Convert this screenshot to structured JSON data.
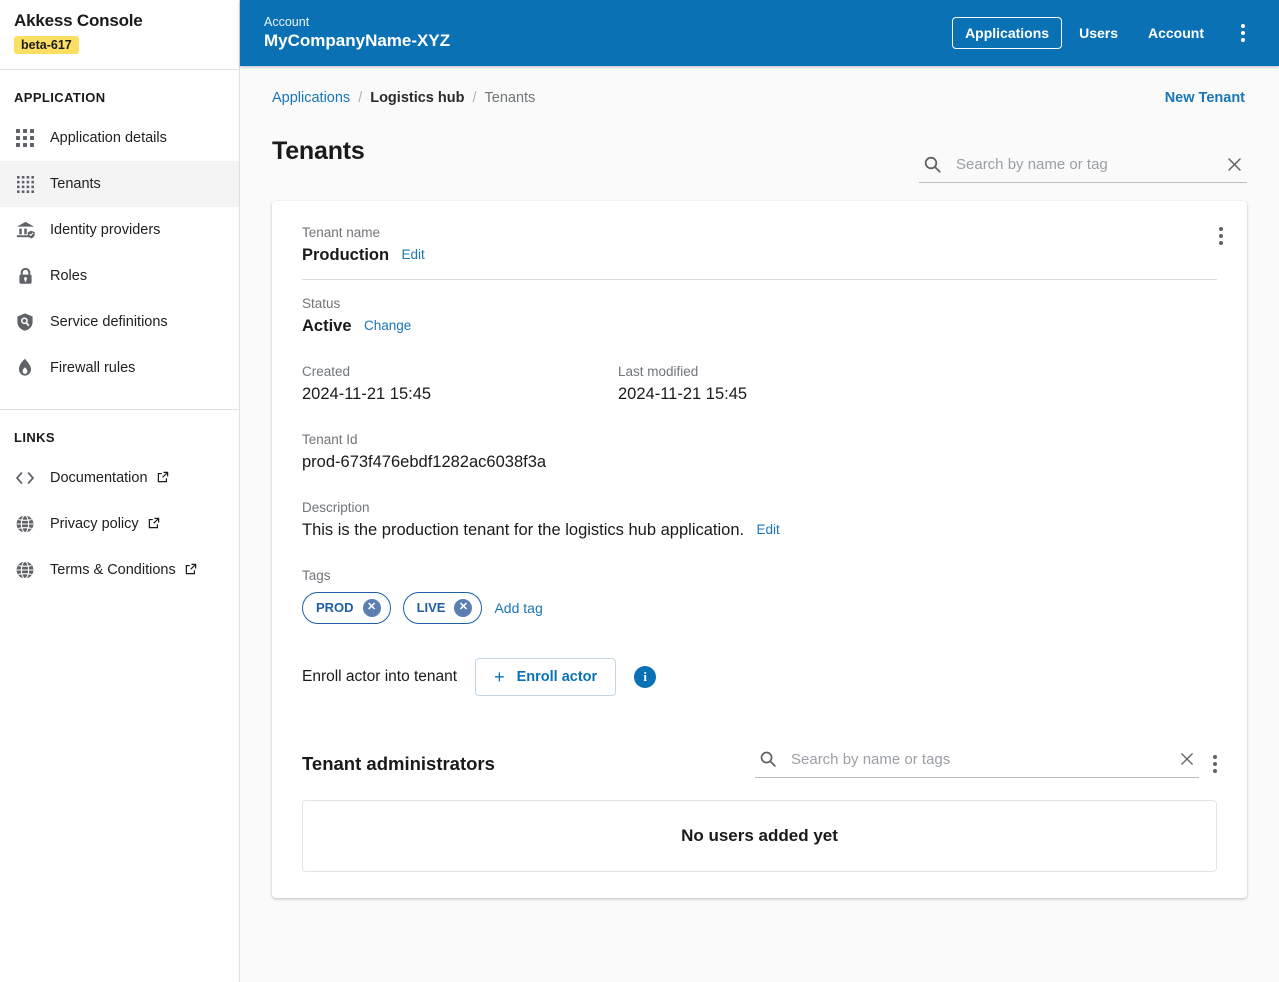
{
  "sidebar": {
    "brand_title": "Akkess Console",
    "version_badge": "beta-617",
    "section_application": "APPLICATION",
    "app_items": [
      {
        "label": "Application details",
        "icon": "grid-3x3-icon"
      },
      {
        "label": "Tenants",
        "icon": "grid-4x4-icon"
      },
      {
        "label": "Identity providers",
        "icon": "bank-shield-icon"
      },
      {
        "label": "Roles",
        "icon": "lock-icon"
      },
      {
        "label": "Service definitions",
        "icon": "shield-search-icon"
      },
      {
        "label": "Firewall rules",
        "icon": "flame-icon"
      }
    ],
    "section_links": "LINKS",
    "link_items": [
      {
        "label": "Documentation",
        "icon": "code-brackets-icon"
      },
      {
        "label": "Privacy policy",
        "icon": "globe-icon"
      },
      {
        "label": "Terms & Conditions",
        "icon": "globe-icon"
      }
    ]
  },
  "topbar": {
    "kicker": "Account",
    "account_name": "MyCompanyName-XYZ",
    "nav": [
      {
        "label": "Applications",
        "active": true
      },
      {
        "label": "Users",
        "active": false
      },
      {
        "label": "Account",
        "active": false
      }
    ]
  },
  "breadcrumb": {
    "applications": "Applications",
    "app_name": "Logistics hub",
    "current": "Tenants",
    "separator": "/"
  },
  "page": {
    "title": "Tenants",
    "new_tenant": "New Tenant"
  },
  "search": {
    "placeholder": "Search by name or tag",
    "value": ""
  },
  "tenant": {
    "name_label": "Tenant name",
    "name_value": "Production",
    "name_edit": "Edit",
    "status_label": "Status",
    "status_value": "Active",
    "status_change": "Change",
    "created_label": "Created",
    "created_value": "2024-11-21 15:45",
    "modified_label": "Last modified",
    "modified_value": "2024-11-21 15:45",
    "id_label": "Tenant Id",
    "id_value": "prod-673f476ebdf1282ac6038f3a",
    "description_label": "Description",
    "description_value": "This is the production tenant for the logistics hub application.",
    "description_edit": "Edit",
    "tags_label": "Tags",
    "tags": [
      {
        "label": "PROD",
        "remove": "✕"
      },
      {
        "label": "LIVE",
        "remove": "✕"
      }
    ],
    "add_tag": "Add tag",
    "enroll_label": "Enroll actor into tenant",
    "enroll_button": "Enroll actor",
    "enroll_plus": "+",
    "info_glyph": "i"
  },
  "administrators": {
    "title": "Tenant administrators",
    "search_placeholder": "Search by name or tags",
    "search_value": "",
    "empty_message": "No users added yet"
  },
  "colors": {
    "brand_blue": "#0a71b4",
    "link_blue": "#1976b8",
    "badge_yellow": "#fbdf63",
    "tag_blue": "#1f5fa8"
  }
}
